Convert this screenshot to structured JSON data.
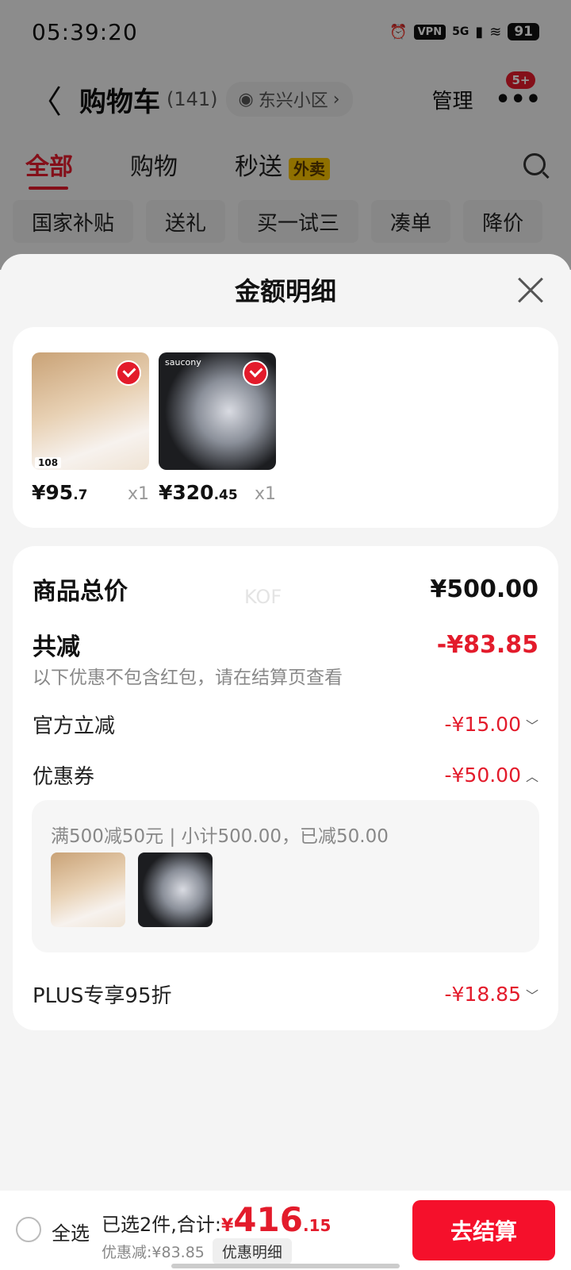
{
  "status": {
    "time": "05:39:20",
    "vpn": "VPN",
    "net": "5G",
    "battery": "91"
  },
  "header": {
    "back": "〈",
    "title": "购物车",
    "count": "(141)",
    "location": "东兴小区",
    "manage": "管理",
    "more": "•••",
    "badge": "5+"
  },
  "tabs": [
    {
      "label": "全部"
    },
    {
      "label": "购物"
    },
    {
      "label": "秒送"
    }
  ],
  "tab_tag": "外卖",
  "chips": [
    "国家补贴",
    "送礼",
    "买一试三",
    "凑单",
    "降价"
  ],
  "sheet": {
    "title": "金额明细",
    "products": [
      {
        "price_int": "¥95",
        "price_dec": ".7",
        "qty": "x1",
        "img_tag": "108",
        "brand": ""
      },
      {
        "price_int": "¥320",
        "price_dec": ".45",
        "qty": "x1",
        "img_tag": "",
        "brand": "saucony"
      }
    ],
    "watermark": "KOF",
    "total_label": "商品总价",
    "total_value": "¥500.00",
    "reduce_label": "共减",
    "reduce_value": "-¥83.85",
    "reduce_note": "以下优惠不包含红包，请在结算页查看",
    "official_label": "官方立减",
    "official_value": "-¥15.00",
    "coupon_label": "优惠券",
    "coupon_value": "-¥50.00",
    "coupon_detail": "满500减50元 | 小计500.00，已减50.00",
    "plus_label": "PLUS专享95折",
    "plus_value": "-¥18.85"
  },
  "bottom": {
    "select_all": "全选",
    "selected": "已选2件,合计:",
    "total_sym": "¥",
    "total_int": "416",
    "total_dec": ".15",
    "discount": "优惠减:¥83.85",
    "detail_btn": "优惠明细",
    "checkout": "去结算"
  },
  "colors": {
    "accent": "#e31b2b",
    "checkout": "#f5102b"
  }
}
